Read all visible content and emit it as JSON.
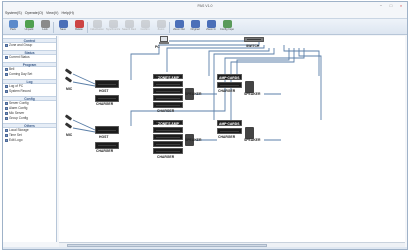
{
  "window": {
    "title": "PAS V1.0"
  },
  "menu": [
    "System(S)",
    "Operate(O)",
    "View(V)",
    "Help(H)"
  ],
  "toolbar": {
    "items": [
      {
        "label": "Pack",
        "icon": "pack-icon",
        "color": "#5b8acb",
        "enabled": true
      },
      {
        "label": "Unpack",
        "icon": "unpack-icon",
        "color": "#4fa04f",
        "enabled": true
      },
      {
        "label": "Lock",
        "icon": "lock-icon",
        "color": "#8a8a8a",
        "enabled": true
      },
      {
        "label": "Save",
        "icon": "save-icon",
        "color": "#4b6fb8",
        "enabled": true
      },
      {
        "label": "Delete",
        "icon": "delete-icon",
        "color": "#c44",
        "enabled": true
      },
      {
        "label": "Initialization",
        "icon": "init-icon",
        "color": "#999",
        "enabled": false
      },
      {
        "label": "Synchronize",
        "icon": "sync-icon",
        "color": "#999",
        "enabled": false
      },
      {
        "label": "Search Device",
        "icon": "search-device-icon",
        "color": "#999",
        "enabled": false
      },
      {
        "label": "Confirm",
        "icon": "confirm-icon",
        "color": "#999",
        "enabled": false
      },
      {
        "label": "Zoom",
        "icon": "zoom-icon",
        "color": "#999",
        "enabled": false
      },
      {
        "label": "Zoom Out",
        "icon": "zoom-out-icon",
        "color": "#4b6fb8",
        "enabled": true
      },
      {
        "label": "Original",
        "icon": "original-icon",
        "color": "#4b6fb8",
        "enabled": true
      },
      {
        "label": "Zoom In",
        "icon": "zoom-in-icon",
        "color": "#4b6fb8",
        "enabled": true
      },
      {
        "label": "Config Import",
        "icon": "config-import-icon",
        "color": "#5a9a5a",
        "enabled": true
      }
    ]
  },
  "sidebar": {
    "sections": [
      {
        "title": "Control",
        "items": [
          "Zone and Group"
        ]
      },
      {
        "title": "Status",
        "items": [
          "Current Status"
        ]
      },
      {
        "title": "Program",
        "items": [
          "Bell",
          "Coming Day Set"
        ]
      },
      {
        "title": "Log",
        "items": [
          "Log of PC",
          "System Record"
        ]
      },
      {
        "title": "Config",
        "items": [
          "Server Config",
          "Alarm Config",
          "Mic Server",
          "Group Config"
        ]
      },
      {
        "title": "Others",
        "items": [
          "Local Storage",
          "Time Set",
          "Edit Logo"
        ]
      }
    ]
  },
  "diagram": {
    "pc": "PC",
    "switch": "SWITCH",
    "mic": "MIC",
    "host": "HOST",
    "charger": "CHARGER",
    "zone_amp": "ZONE'S AMP",
    "amp_cards": "AMP CARDS",
    "speaker": "SPEAKER"
  },
  "colors": {
    "link": "#5b7fa8",
    "device": "#1c1c1c",
    "accent": "#3a5a88"
  }
}
